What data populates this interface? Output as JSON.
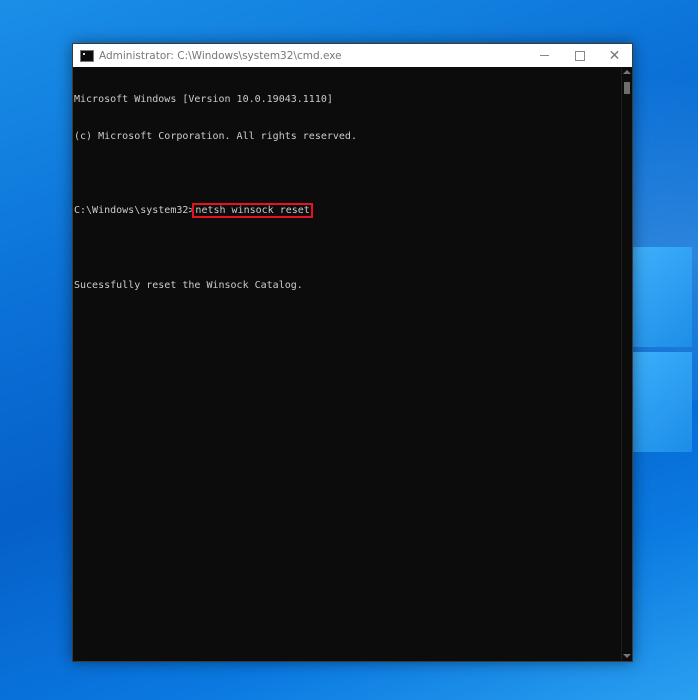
{
  "window": {
    "title": "Administrator: C:\\Windows\\system32\\cmd.exe",
    "icon": "cmd-icon",
    "controls": {
      "minimize": "minimize-icon",
      "maximize": "maximize-icon",
      "close": "close-icon"
    }
  },
  "console": {
    "line1": "Microsoft Windows [Version 10.0.19043.1110]",
    "line2": "(c) Microsoft Corporation. All rights reserved.",
    "prompt": "C:\\Windows\\system32>",
    "command": "netsh winsock reset",
    "output": "Sucessfully reset the Winsock Catalog."
  },
  "colors": {
    "console_bg": "#0c0c0c",
    "console_text": "#cccccc",
    "highlight_border": "#e81123",
    "desktop_blue": "#0a6fd6"
  }
}
